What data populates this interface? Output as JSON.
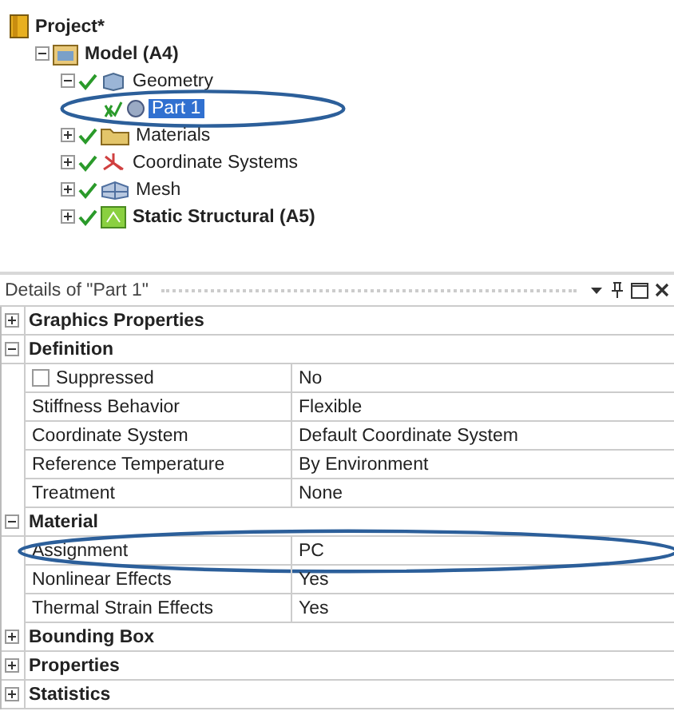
{
  "tree": [
    {
      "label": "Project*",
      "kind": "project",
      "bold": true,
      "children": [
        {
          "label": "Model (A4)",
          "kind": "model",
          "bold": true,
          "expanded": true,
          "children": [
            {
              "label": "Geometry",
              "kind": "geometry",
              "status": {
                "kind": "ok"
              },
              "expanded": true,
              "children": [
                {
                  "label": "Part 1",
                  "kind": "part",
                  "status": {
                    "kind": "partial"
                  },
                  "selected": true,
                  "circled": true
                }
              ]
            },
            {
              "label": "Materials",
              "kind": "materials",
              "status": {
                "kind": "ok"
              },
              "expanded": false
            },
            {
              "label": "Coordinate Systems",
              "kind": "coordinates",
              "status": {
                "kind": "ok"
              },
              "expanded": false
            },
            {
              "label": "Mesh",
              "kind": "mesh",
              "status": {
                "kind": "ok"
              },
              "expanded": false
            },
            {
              "label": "Static Structural (A5)",
              "kind": "analysis",
              "status": {
                "kind": "ok"
              },
              "bold": true,
              "expanded": false
            }
          ]
        }
      ]
    }
  ],
  "details": {
    "title": "Details of \"Part 1\"",
    "groups": [
      {
        "label": "Graphics Properties",
        "expanded": false
      },
      {
        "label": "Definition",
        "expanded": true,
        "rows": [
          {
            "label": "Suppressed",
            "value": "No",
            "kind": "checkbox",
            "checked": false
          },
          {
            "label": "Stiffness Behavior",
            "value": "Flexible",
            "kind": "text"
          },
          {
            "label": "Coordinate System",
            "value": "Default Coordinate System",
            "kind": "text"
          },
          {
            "label": "Reference Temperature",
            "value": "By Environment",
            "kind": "text"
          },
          {
            "label": "Treatment",
            "value": "None",
            "kind": "text"
          }
        ]
      },
      {
        "label": "Material",
        "expanded": true,
        "rows": [
          {
            "label": "Assignment",
            "value": "PC",
            "kind": "text",
            "circled": true
          },
          {
            "label": "Nonlinear Effects",
            "value": "Yes",
            "kind": "text"
          },
          {
            "label": "Thermal Strain Effects",
            "value": "Yes",
            "kind": "text"
          }
        ]
      },
      {
        "label": "Bounding Box",
        "expanded": false
      },
      {
        "label": "Properties",
        "expanded": false
      },
      {
        "label": "Statistics",
        "expanded": false
      }
    ]
  }
}
